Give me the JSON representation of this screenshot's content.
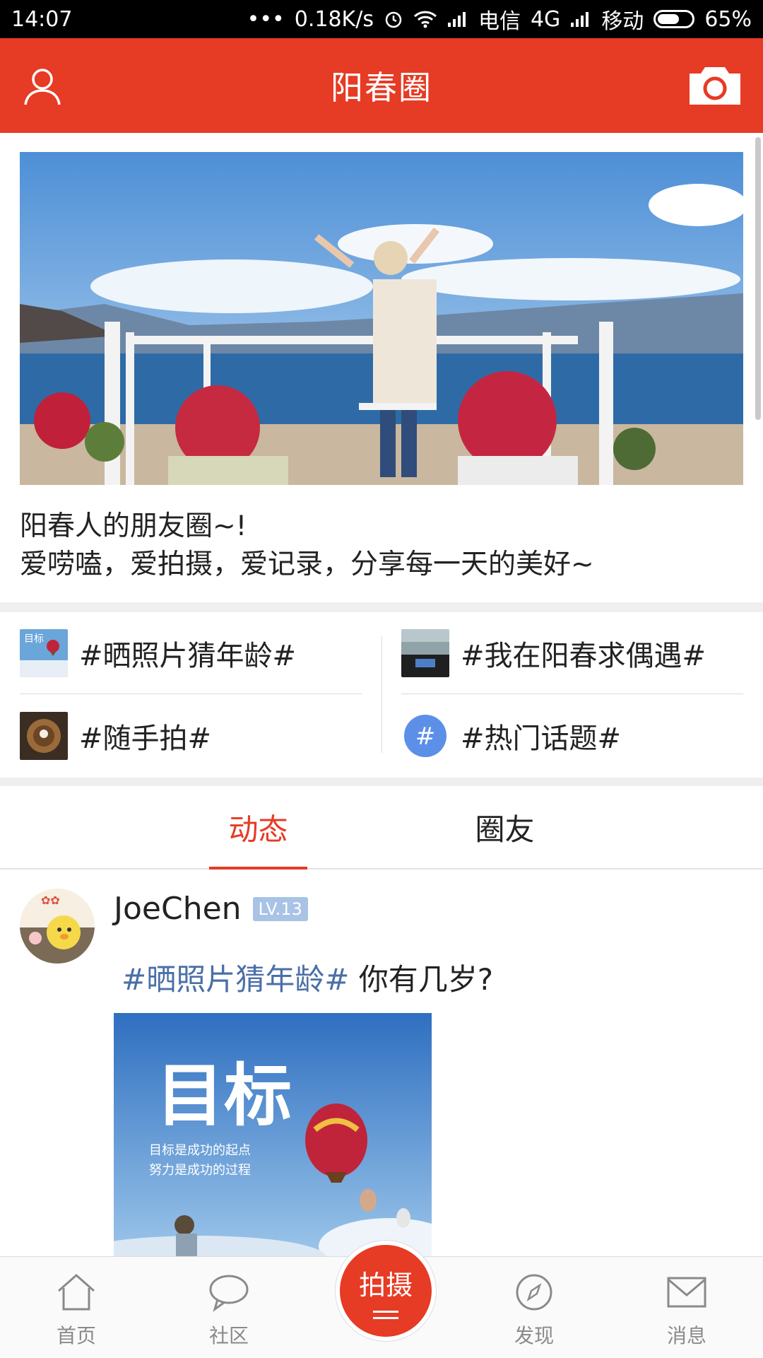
{
  "status_bar": {
    "time": "14:07",
    "dots": "•••",
    "speed": "0.18K/s",
    "carrier1": "电信",
    "network": "4G",
    "carrier2": "移动",
    "battery_text": "65%",
    "battery_level": 0.65
  },
  "header": {
    "title": "阳春圈",
    "left_icon": "user-profile-icon",
    "right_icon": "camera-icon"
  },
  "intro": {
    "line1": "阳春人的朋友圈~!",
    "line2": "爱唠嗑，爱拍摄，爱记录，分享每一天的美好~"
  },
  "topics": [
    {
      "label": "#晒照片猜年龄#",
      "thumb_icon": "balloon-thumbnail"
    },
    {
      "label": "#我在阳春求偶遇#",
      "thumb_icon": "car-dashboard-thumbnail"
    },
    {
      "label": "#随手拍#",
      "thumb_icon": "bowl-thumbnail"
    },
    {
      "label": "#热门话题#",
      "thumb_icon": "hashtag-icon"
    }
  ],
  "hashtag_glyph": "#",
  "tabs": [
    {
      "label": "动态",
      "active": true
    },
    {
      "label": "圈友",
      "active": false
    }
  ],
  "post": {
    "username": "JoeChen",
    "level": "LV.13",
    "tag": "#晒照片猜年龄#",
    "text": " 你有几岁?",
    "image_title": "目标",
    "image_line1": "目标是成功的起点",
    "image_line2": "努力是成功的过程"
  },
  "bottom_nav": [
    {
      "label": "首页",
      "icon": "home-icon"
    },
    {
      "label": "社区",
      "icon": "chat-bubble-icon"
    },
    {
      "label": "发现",
      "icon": "compass-icon"
    },
    {
      "label": "消息",
      "icon": "envelope-icon"
    }
  ],
  "shoot_button": {
    "label": "拍摄"
  },
  "colors": {
    "accent": "#e63b24",
    "tag_blue": "#4a6fa8",
    "badge_blue": "#a9c3e6"
  }
}
